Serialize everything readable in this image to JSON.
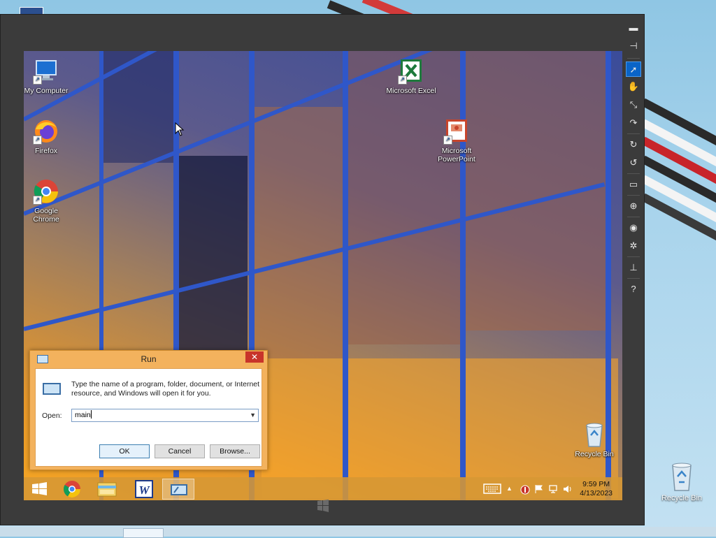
{
  "host": {
    "recycle_bin_label": "Recycle Bin"
  },
  "desktop": {
    "icons": [
      {
        "label": "My Computer"
      },
      {
        "label": "Firefox"
      },
      {
        "label": "Google Chrome"
      },
      {
        "label": "Microsoft Excel"
      },
      {
        "label": "Microsoft PowerPoint"
      },
      {
        "label": "Recycle Bin"
      }
    ]
  },
  "run_dialog": {
    "title": "Run",
    "close_glyph": "✕",
    "description": "Type the name of a program, folder, document, or Internet resource, and Windows will open it for you.",
    "open_label": "Open:",
    "open_value": "main",
    "ok_label": "OK",
    "cancel_label": "Cancel",
    "browse_label": "Browse..."
  },
  "taskbar": {
    "pinned": [
      {
        "icon": "start-icon"
      },
      {
        "icon": "chrome-icon"
      },
      {
        "icon": "file-explorer-icon"
      },
      {
        "icon": "word-icon"
      },
      {
        "icon": "run-icon"
      }
    ],
    "clock_time": "9:59 PM",
    "clock_date": "4/13/2023"
  },
  "emulator_tools": [
    {
      "icon": "minimize-icon",
      "glyph": "▬"
    },
    {
      "icon": "pin-icon",
      "glyph": "⊣"
    },
    {
      "icon": "pointer-icon",
      "glyph": "➚"
    },
    {
      "icon": "hand-icon",
      "glyph": "✋"
    },
    {
      "icon": "pinch-icon",
      "glyph": "⤡"
    },
    {
      "icon": "rotate-gesture-icon",
      "glyph": "↷"
    },
    {
      "icon": "rotate-clockwise-icon",
      "glyph": "↻"
    },
    {
      "icon": "rotate-counterclockwise-icon",
      "glyph": "↺"
    },
    {
      "icon": "resolution-icon",
      "glyph": "▭"
    },
    {
      "icon": "network-icon",
      "glyph": "⊕"
    },
    {
      "icon": "camera-icon",
      "glyph": "◉"
    },
    {
      "icon": "settings-icon",
      "glyph": "✲"
    },
    {
      "icon": "connect-icon",
      "glyph": "⊥"
    },
    {
      "icon": "help-icon",
      "glyph": "?"
    }
  ],
  "colors": {
    "run_frame": "#f3b25d",
    "taskbar": "#d69734",
    "close_red": "#c8342a",
    "active_tool": "#0a64c8"
  }
}
